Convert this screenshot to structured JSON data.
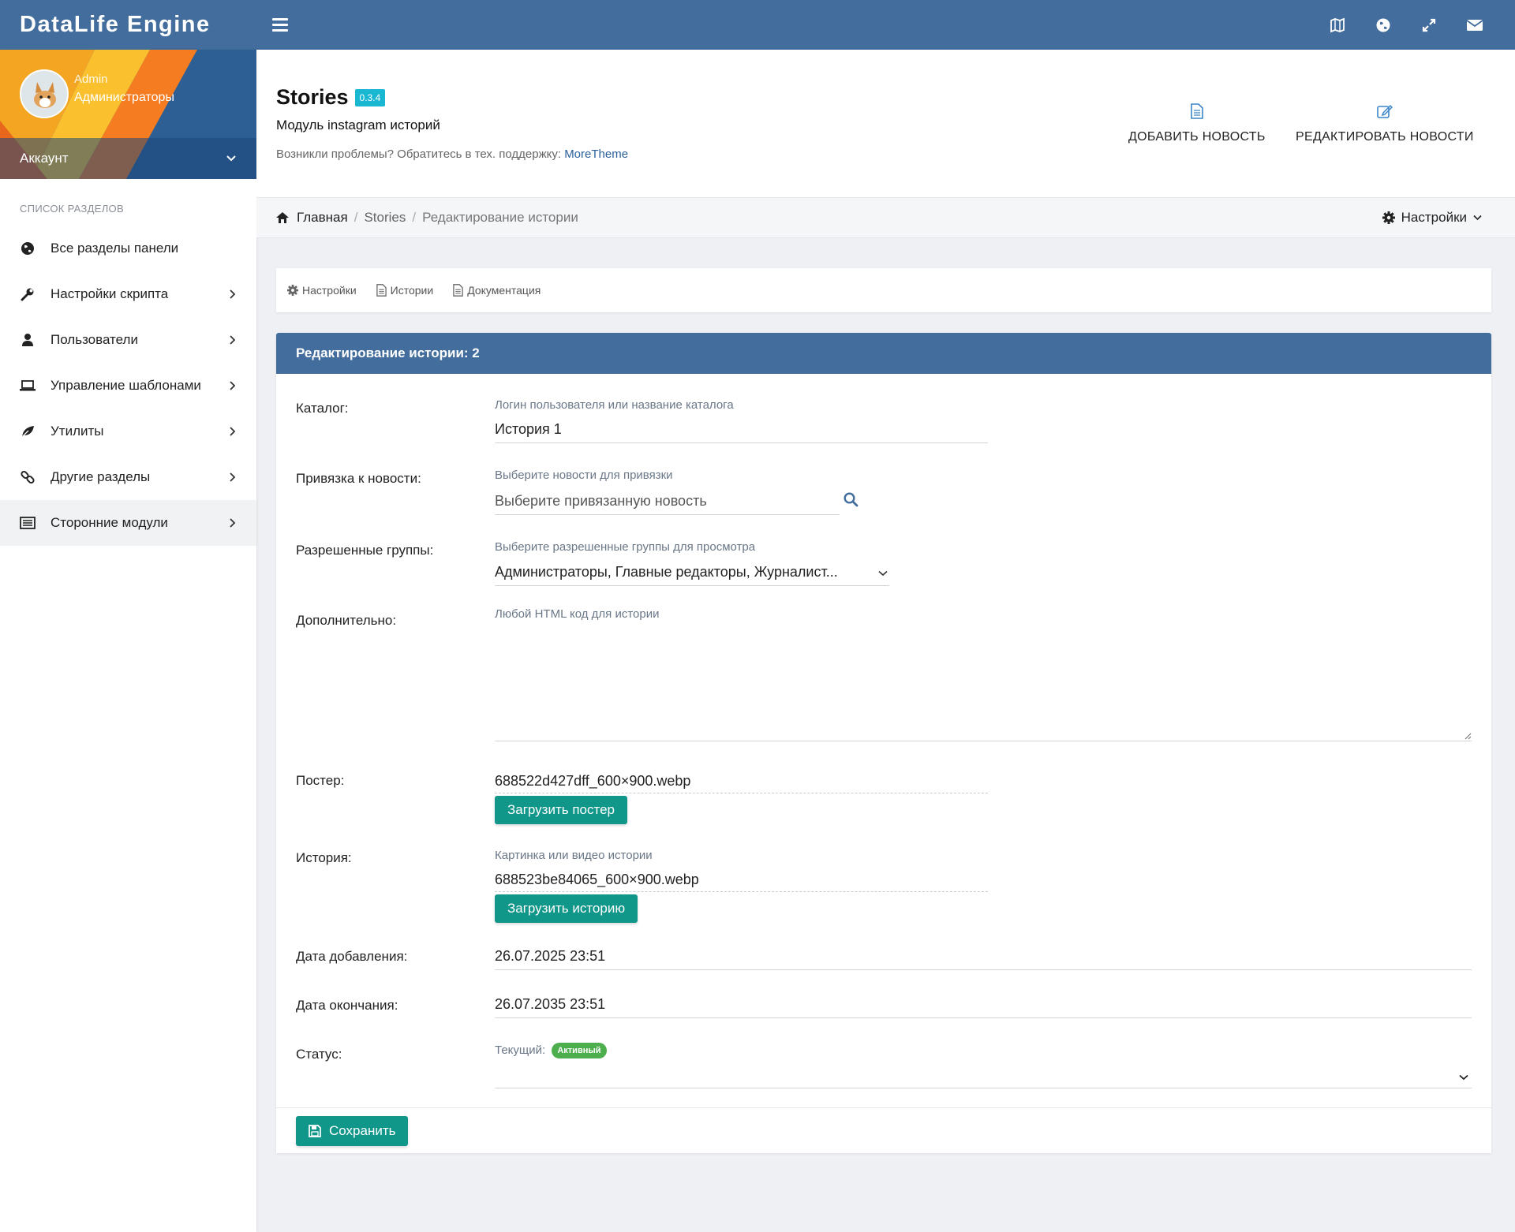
{
  "topbar": {
    "brand": "DataLife Engine",
    "icons": [
      "map-icon",
      "globe-icon",
      "expand-icon",
      "envelope-icon"
    ]
  },
  "sidebar": {
    "user": {
      "name": "Admin",
      "group": "Администраторы"
    },
    "account_label": "Аккаунт",
    "caption": "СПИСОК РАЗДЕЛОВ",
    "items": [
      {
        "label": "Все разделы панели",
        "icon": "globe-icon"
      },
      {
        "label": "Настройки скрипта",
        "icon": "wrench-icon"
      },
      {
        "label": "Пользователи",
        "icon": "user-icon"
      },
      {
        "label": "Управление шаблонами",
        "icon": "laptop-icon"
      },
      {
        "label": "Утилиты",
        "icon": "leaf-icon"
      },
      {
        "label": "Другие разделы",
        "icon": "link-icon"
      },
      {
        "label": "Сторонние модули",
        "icon": "list-icon"
      }
    ]
  },
  "header": {
    "title": "Stories",
    "version": "0.3.4",
    "subtitle": "Модуль instagram историй",
    "support_text": "Возникли проблемы? Обратитесь в тех. поддержку:",
    "support_link": "MoreTheme",
    "actions": [
      {
        "label": "ДОБАВИТЬ НОВОСТЬ",
        "icon": "file-icon"
      },
      {
        "label": "РЕДАКТИРОВАТЬ НОВОСТИ",
        "icon": "edit-icon"
      }
    ]
  },
  "breadcrumb": {
    "home": "Главная",
    "module": "Stories",
    "current": "Редактирование истории",
    "settings": "Настройки"
  },
  "tabs": [
    "Настройки",
    "Истории",
    "Документация"
  ],
  "form": {
    "title": "Редактирование истории: 2",
    "catalog": {
      "label": "Каталог:",
      "hint": "Логин пользователя или название каталога",
      "value": "История 1"
    },
    "news": {
      "label": "Привязка к новости:",
      "hint": "Выберите новости для привязки",
      "placeholder": "Выберите привязанную новость"
    },
    "groups": {
      "label": "Разрешенные группы:",
      "hint": "Выберите разрешенные группы для просмотра",
      "value": "Администраторы, Главные редакторы, Журналист..."
    },
    "extra": {
      "label": "Дополнительно:",
      "placeholder": "Любой HTML код для истории"
    },
    "poster": {
      "label": "Постер:",
      "file": "688522d427dff_600×900.webp",
      "button": "Загрузить постер"
    },
    "story": {
      "label": "История:",
      "hint": "Картинка или видео истории",
      "file": "688523be84065_600×900.webp",
      "button": "Загрузить историю"
    },
    "date_added": {
      "label": "Дата добавления:",
      "value": "26.07.2025 23:51"
    },
    "date_end": {
      "label": "Дата окончания:",
      "value": "26.07.2035 23:51"
    },
    "status": {
      "label": "Статус:",
      "current_label": "Текущий:",
      "badge": "Активный"
    },
    "save_button": "Сохранить"
  },
  "colors": {
    "primary": "#436d9c",
    "accent": "#11968a",
    "badge_version": "#1ab7d3",
    "status_active": "#4cae4c"
  }
}
